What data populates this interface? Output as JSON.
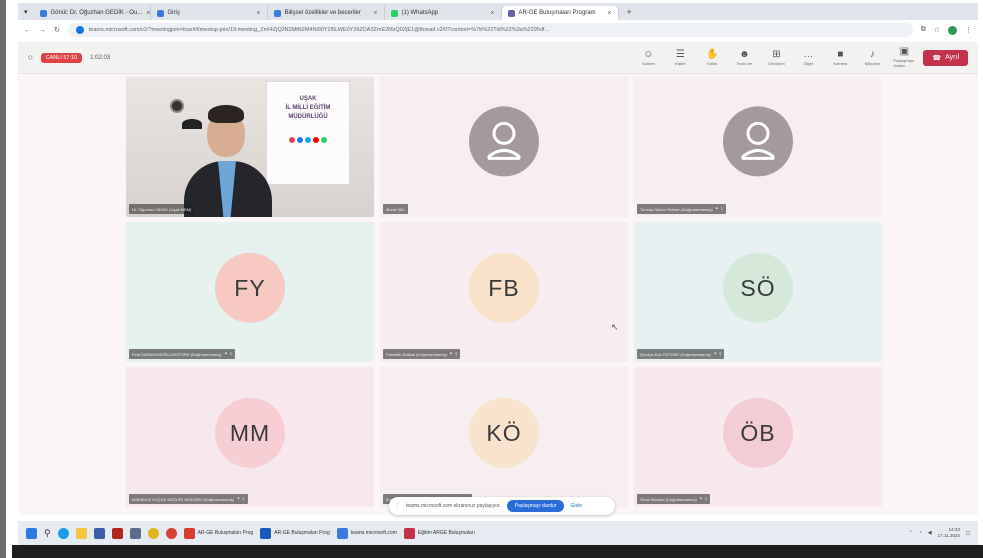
{
  "browser": {
    "tabs": [
      {
        "label": "Gönül: Dr. Oğuzhan GEDİK - Ou...",
        "color": "#3b7be0",
        "active": false
      },
      {
        "label": "Giriş",
        "color": "#3b7be0",
        "active": false
      },
      {
        "label": "Bilişsel özellikler ve beceriler",
        "color": "#3b7be0",
        "active": false
      },
      {
        "label": "(1) WhatsApp",
        "color": "#25d366",
        "active": false
      },
      {
        "label": "AR-GE Buluşmaları Program",
        "color": "#6264a7",
        "active": true
      }
    ],
    "new_tab": "+",
    "url": "teams.microsoft.com/v2/?meetingjoin=true#/l/meetup-join/19:meeting_ZmI4ZjQ2N2MtN2M4Ni00Y2I5LWE0Y2ItZDA3ZmE2MzQ0ZjE1@thread.v2/0?context=%7b%22Tid%22%3a%2295df..."
  },
  "meeting_bar": {
    "recording": "CANLI 57:10",
    "timer": "1:02:03",
    "tools": [
      {
        "label": "Sohbet",
        "icon": "☺"
      },
      {
        "label": "Kişiler",
        "icon": "☰"
      },
      {
        "label": "Kaldır",
        "icon": "✋"
      },
      {
        "label": "Tepki ver",
        "icon": "☻"
      },
      {
        "label": "Görünüm",
        "icon": "⊞"
      },
      {
        "label": "Diğer",
        "icon": "…"
      },
      {
        "label": "Kamera",
        "icon": "■"
      },
      {
        "label": "Mikrofon",
        "icon": "♪"
      },
      {
        "label": "Paylaşmayı durdur",
        "icon": "▣"
      }
    ],
    "leave_label": "Ayrıl"
  },
  "participants": [
    {
      "name": "Dr. Oğuzhan GEDİK (Uşak MEM)",
      "initials": "",
      "type": "video",
      "bg": "#ded8d4",
      "avatar": "",
      "mic": false
    },
    {
      "name": "Murat IŞIK",
      "initials": "",
      "type": "person",
      "bg": "#f7eef2",
      "avatar": "#a49a9e",
      "mic": false
    },
    {
      "name": "Tuncay Güven Selmen (Doğrulanmamış)",
      "initials": "",
      "type": "person",
      "bg": "#f7eef2",
      "avatar": "#a49a9e",
      "mic": true
    },
    {
      "name": "Fırat KARAHANOĞLU/ÖZTÜRK (Doğrulanmamış)",
      "initials": "FY",
      "type": "initials",
      "bg": "#e6f2ee",
      "avatar": "#f6c9c2",
      "mic": true
    },
    {
      "name": "Fahrettin Bakkal (Doğrulanmamış)",
      "initials": "FB",
      "type": "initials",
      "bg": "#f7ecef",
      "avatar": "#f9e1c7",
      "mic": true
    },
    {
      "name": "Şenaya Ece ÖZTÜRK (Doğrulanmamış)",
      "initials": "SÖ",
      "type": "initials",
      "bg": "#e7f1f2",
      "avatar": "#d4e9da",
      "mic": true
    },
    {
      "name": "MAKBULE KÜÇÜK SAĞLIĞI MÜDÜRÜ (Doğrulanmamış)",
      "initials": "MM",
      "type": "initials",
      "bg": "#f6e8ed",
      "avatar": "#f6ced4",
      "mic": true
    },
    {
      "name": "Kudret ÖZDEMİR ZOR (Doğrulanmamış)",
      "initials": "KÖ",
      "type": "initials",
      "bg": "#f7eef0",
      "avatar": "#f9e3cd",
      "mic": true
    },
    {
      "name": "Ömer Bozkurt (Doğrulanmamış)",
      "initials": "ÖB",
      "type": "initials",
      "bg": "#f7e9ed",
      "avatar": "#f3ccd4",
      "mic": true
    }
  ],
  "webcam": {
    "banner_lines": [
      "UŞAK",
      "İL MİLLİ EĞİTİM",
      "MÜDÜRLÜĞÜ"
    ]
  },
  "share_pill": {
    "text": "teams.microsoft.com ekranınızı paylaşıyor.",
    "stop": "Paylaşmayı durdur",
    "hide": "Gizle"
  },
  "taskbar": {
    "items": [
      {
        "label": "AR-GE Buluşmaları Prog",
        "color": "#d93b2b"
      },
      {
        "label": "AR-GE Buluşmaları Prog",
        "color": "#185abd"
      },
      {
        "label": "teams.microsoft.com",
        "color": "#3b7be0"
      },
      {
        "label": "Eğitim ARGE Buluşmaları",
        "color": "#c4314b"
      }
    ],
    "time": "14:23",
    "date": "17.11.2024"
  }
}
